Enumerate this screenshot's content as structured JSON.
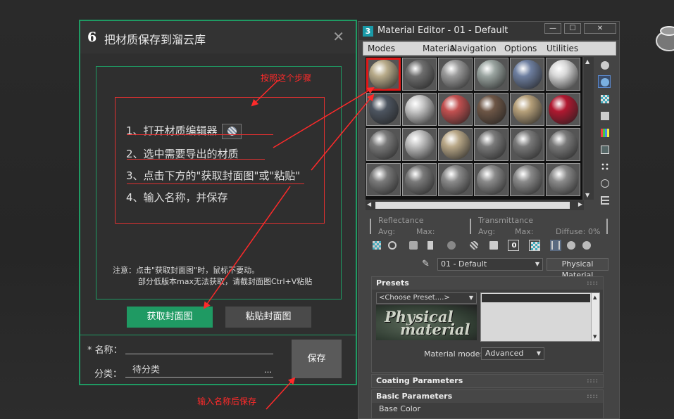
{
  "dialog": {
    "title": "把材质保存到溜云库",
    "logo_glyph": "6",
    "close_glyph": "✕",
    "annotation_step": "按照这个步骤",
    "steps": [
      "1、打开材质编辑器",
      "2、选中需要导出的材质",
      "3、点击下方的\"获取封面图\"或\"粘贴\"",
      "4、输入名称，并保存"
    ],
    "note_line1": "注意：点击\"获取封面图\"时，鼠标不要动。",
    "note_line2": "部分低版本max无法获取，请截封面图Ctrl+V粘贴",
    "btn_capture": "获取封面图",
    "btn_paste": "粘贴封面图",
    "label_name": "* 名称：",
    "name_value": "",
    "label_category": "分类：",
    "category_value": "待分类",
    "category_more": "…",
    "btn_save": "保存",
    "annotation_save": "输入名称后保存"
  },
  "material_editor": {
    "title": "Material Editor - 01 - Default",
    "app_icon": "3",
    "btn_min": "—",
    "btn_max": "☐",
    "btn_close": "✕",
    "menus": [
      "Modes",
      "Material",
      "Navigation",
      "Options",
      "Utilities"
    ],
    "slots": [
      {
        "color": "#b8ab8a",
        "selected": true
      },
      {
        "color": "#6e6e6e"
      },
      {
        "color": "#9a9a9a"
      },
      {
        "color": "#9aa4a0"
      },
      {
        "color": "#6e7fa0"
      },
      {
        "color": "#d8d8d8"
      },
      {
        "color": "#4d5560"
      },
      {
        "color": "#c8c8c8"
      },
      {
        "color": "#c25050"
      },
      {
        "color": "#6d5646"
      },
      {
        "color": "#b6a07a"
      },
      {
        "color": "#b01830"
      },
      {
        "color": "#7a7a7a"
      },
      {
        "color": "#c0c0c0"
      },
      {
        "color": "#b9a888"
      },
      {
        "color": "#7a7a7a"
      },
      {
        "color": "#7a7a7a"
      },
      {
        "color": "#7a7a7a"
      },
      {
        "color": "#7a7a7a"
      },
      {
        "color": "#7a7a7a"
      },
      {
        "color": "#8a8a8a"
      },
      {
        "color": "#8a8a8a"
      },
      {
        "color": "#8a8a8a"
      },
      {
        "color": "#8a8a8a"
      }
    ],
    "reflectance_label": "Reflectance",
    "transmittance_label": "Transmittance",
    "avg_label": "Avg:",
    "max_label": "Max:",
    "diffuse_label": "Diffuse:",
    "diffuse_value": "0%",
    "material_name": "01 - Default",
    "material_type": "Physical Material",
    "presets_title": "Presets",
    "preset_choose": "<Choose Preset....>",
    "preset_image_line1": "Physical",
    "preset_image_line2": "material",
    "material_mode_label": "Material mode:",
    "material_mode_value": "Advanced",
    "coating_title": "Coating Parameters",
    "basic_title": "Basic Parameters",
    "base_color_label": "Base Color",
    "grip": "::::"
  },
  "colors": {
    "accent_green": "#1f9a63",
    "annotation_red": "#ff2a2a",
    "selection_red": "#e01818"
  }
}
